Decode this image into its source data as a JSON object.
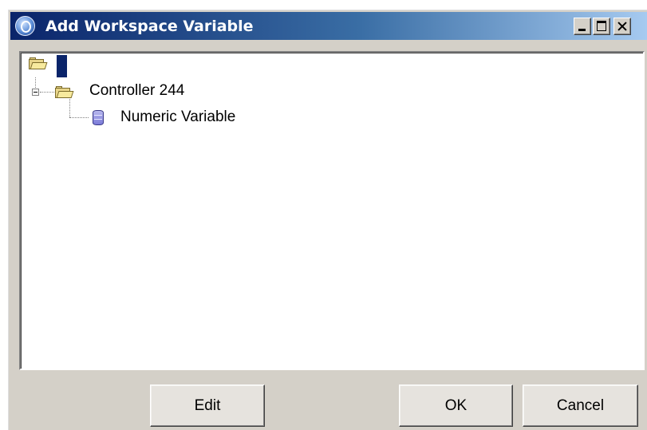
{
  "window": {
    "title": "Add Workspace Variable",
    "controls": [
      "minimize-icon",
      "maximize-icon",
      "close-icon"
    ]
  },
  "tree": {
    "root": {
      "label": "",
      "icon": "folder-open-icon",
      "selected": true
    },
    "nodes": [
      {
        "label": "Controller 244",
        "icon": "folder-open-icon",
        "expanded": true,
        "children": [
          {
            "label": "Numeric Variable",
            "icon": "database-icon"
          }
        ]
      }
    ]
  },
  "buttons": {
    "edit": "Edit",
    "ok": "OK",
    "cancel": "Cancel"
  },
  "colors": {
    "title_bar_start": "#0a246a",
    "title_bar_end": "#a6caf0",
    "selection": "#0a246a",
    "dialog_bg": "#d4d0c8"
  }
}
